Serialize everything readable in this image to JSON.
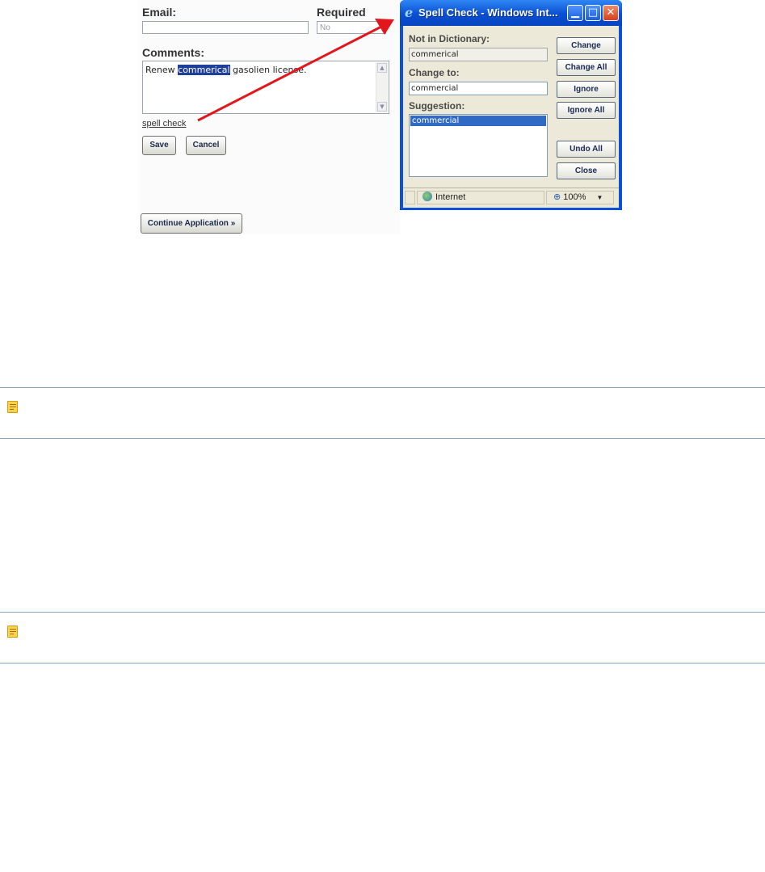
{
  "form": {
    "email_label": "Email:",
    "email_value": "",
    "required_label": "Required",
    "required_value": "No",
    "comments_label": "Comments:",
    "comments_before": "Renew ",
    "comments_selected": "commerical",
    "comments_after": " gasolien license.",
    "spell_check_link": "spell check",
    "save_button": "Save",
    "cancel_button": "Cancel",
    "continue_button": "Continue Application »"
  },
  "popup": {
    "title": "Spell Check - Windows Int...",
    "not_in_dictionary_label": "Not in Dictionary:",
    "not_in_dictionary_value": "commerical",
    "change_to_label": "Change to:",
    "change_to_value": "commercial",
    "suggestion_label": "Suggestion:",
    "suggestions": [
      "commercial"
    ],
    "buttons": {
      "change": "Change",
      "change_all": "Change All",
      "ignore": "Ignore",
      "ignore_all": "Ignore All",
      "undo_all": "Undo All",
      "close": "Close"
    },
    "status_zone": "Internet",
    "zoom": "100%"
  },
  "colors": {
    "arrow": "#e3161b",
    "title_bar": "#0a4fd2",
    "selection": "#316ac5",
    "note_icon": "#ffd44a"
  },
  "icons": [
    "ie-logo-icon",
    "minimize-icon",
    "maximize-icon",
    "close-icon",
    "globe-icon",
    "zoom-icon",
    "note-icon"
  ]
}
